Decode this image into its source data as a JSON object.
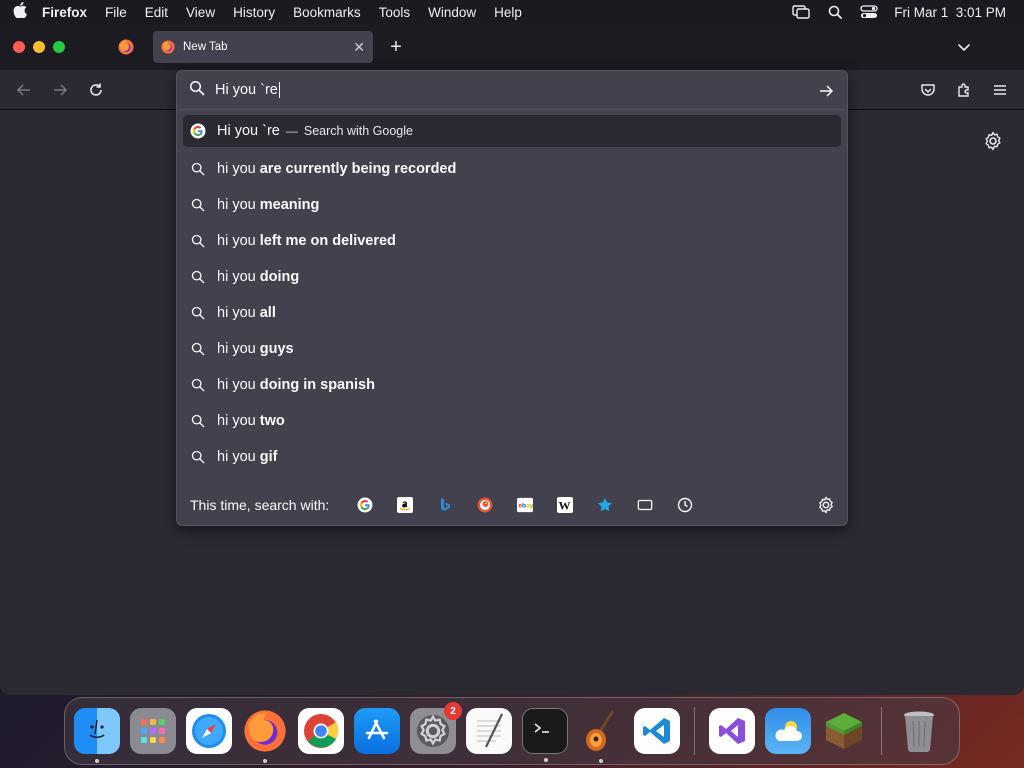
{
  "menubar": {
    "app_name": "Firefox",
    "items": [
      "File",
      "Edit",
      "View",
      "History",
      "Bookmarks",
      "Tools",
      "Window",
      "Help"
    ],
    "datetime": "Fri Mar 1  3:01 PM"
  },
  "tabs": {
    "active_title": "New Tab",
    "close_glyph": "✕",
    "new_tab_glyph": "+"
  },
  "urlbar": {
    "value": "Hi you `re",
    "selected_result": {
      "text": "Hi you `re",
      "separator": "—",
      "action": "Search with Google"
    },
    "suggestions": [
      {
        "prefix": "hi you ",
        "bold": "are currently being recorded"
      },
      {
        "prefix": "hi you ",
        "bold": "meaning"
      },
      {
        "prefix": "hi you ",
        "bold": "left me on delivered"
      },
      {
        "prefix": "hi you ",
        "bold": "doing"
      },
      {
        "prefix": "hi you ",
        "bold": "all"
      },
      {
        "prefix": "hi you ",
        "bold": "guys"
      },
      {
        "prefix": "hi you ",
        "bold": "doing in spanish"
      },
      {
        "prefix": "hi you ",
        "bold": "two"
      },
      {
        "prefix": "hi you ",
        "bold": "gif"
      }
    ],
    "oneoff_label": "This time, search with:",
    "engines": [
      "google-icon",
      "amazon-icon",
      "bing-icon",
      "duckduckgo-icon",
      "ebay-icon",
      "wikipedia-icon",
      "bookmarks-icon",
      "tabs-icon",
      "history-icon"
    ]
  },
  "dock": {
    "settings_badge": "2",
    "apps": [
      "finder",
      "launchpad",
      "safari",
      "firefox",
      "chrome",
      "app-store",
      "system-settings",
      "textedit",
      "terminal",
      "garageband",
      "vscode",
      "visual-studio",
      "weather",
      "minecraft",
      "trash"
    ]
  },
  "colors": {
    "accent": "#42414d",
    "toolbar": "#2b2a33",
    "tabstrip": "#1c1b22"
  }
}
